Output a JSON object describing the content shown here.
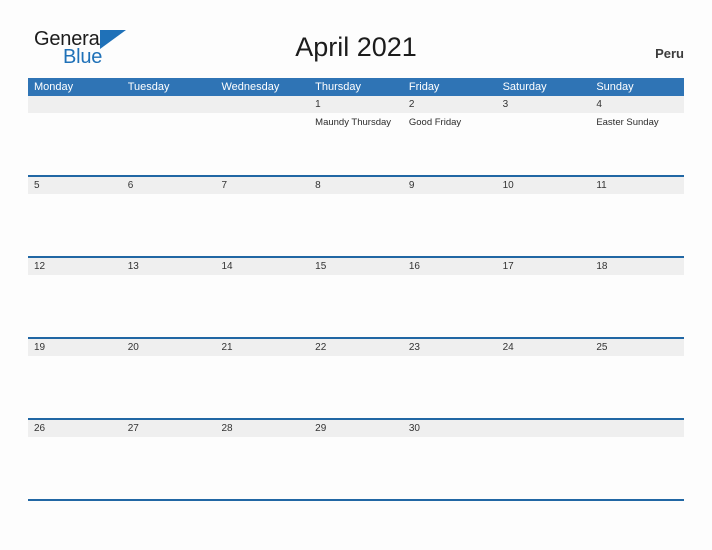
{
  "brand": {
    "word_one": "General",
    "word_two": "Blue",
    "flag_icon": "triangle-flag-icon",
    "accent_color": "#1f71b8"
  },
  "header": {
    "title": "April 2021",
    "country": "Peru"
  },
  "colors": {
    "header_bar": "#2f74b5",
    "week_divider": "#2167a4",
    "date_strip": "#efefef",
    "page_background": "#fdfdfd"
  },
  "calendar": {
    "weekdays": [
      "Monday",
      "Tuesday",
      "Wednesday",
      "Thursday",
      "Friday",
      "Saturday",
      "Sunday"
    ],
    "weeks": [
      [
        {
          "date": "",
          "event": ""
        },
        {
          "date": "",
          "event": ""
        },
        {
          "date": "",
          "event": ""
        },
        {
          "date": "1",
          "event": "Maundy Thursday"
        },
        {
          "date": "2",
          "event": "Good Friday"
        },
        {
          "date": "3",
          "event": ""
        },
        {
          "date": "4",
          "event": "Easter Sunday"
        }
      ],
      [
        {
          "date": "5",
          "event": ""
        },
        {
          "date": "6",
          "event": ""
        },
        {
          "date": "7",
          "event": ""
        },
        {
          "date": "8",
          "event": ""
        },
        {
          "date": "9",
          "event": ""
        },
        {
          "date": "10",
          "event": ""
        },
        {
          "date": "11",
          "event": ""
        }
      ],
      [
        {
          "date": "12",
          "event": ""
        },
        {
          "date": "13",
          "event": ""
        },
        {
          "date": "14",
          "event": ""
        },
        {
          "date": "15",
          "event": ""
        },
        {
          "date": "16",
          "event": ""
        },
        {
          "date": "17",
          "event": ""
        },
        {
          "date": "18",
          "event": ""
        }
      ],
      [
        {
          "date": "19",
          "event": ""
        },
        {
          "date": "20",
          "event": ""
        },
        {
          "date": "21",
          "event": ""
        },
        {
          "date": "22",
          "event": ""
        },
        {
          "date": "23",
          "event": ""
        },
        {
          "date": "24",
          "event": ""
        },
        {
          "date": "25",
          "event": ""
        }
      ],
      [
        {
          "date": "26",
          "event": ""
        },
        {
          "date": "27",
          "event": ""
        },
        {
          "date": "28",
          "event": ""
        },
        {
          "date": "29",
          "event": ""
        },
        {
          "date": "30",
          "event": ""
        },
        {
          "date": "",
          "event": ""
        },
        {
          "date": "",
          "event": ""
        }
      ]
    ]
  }
}
